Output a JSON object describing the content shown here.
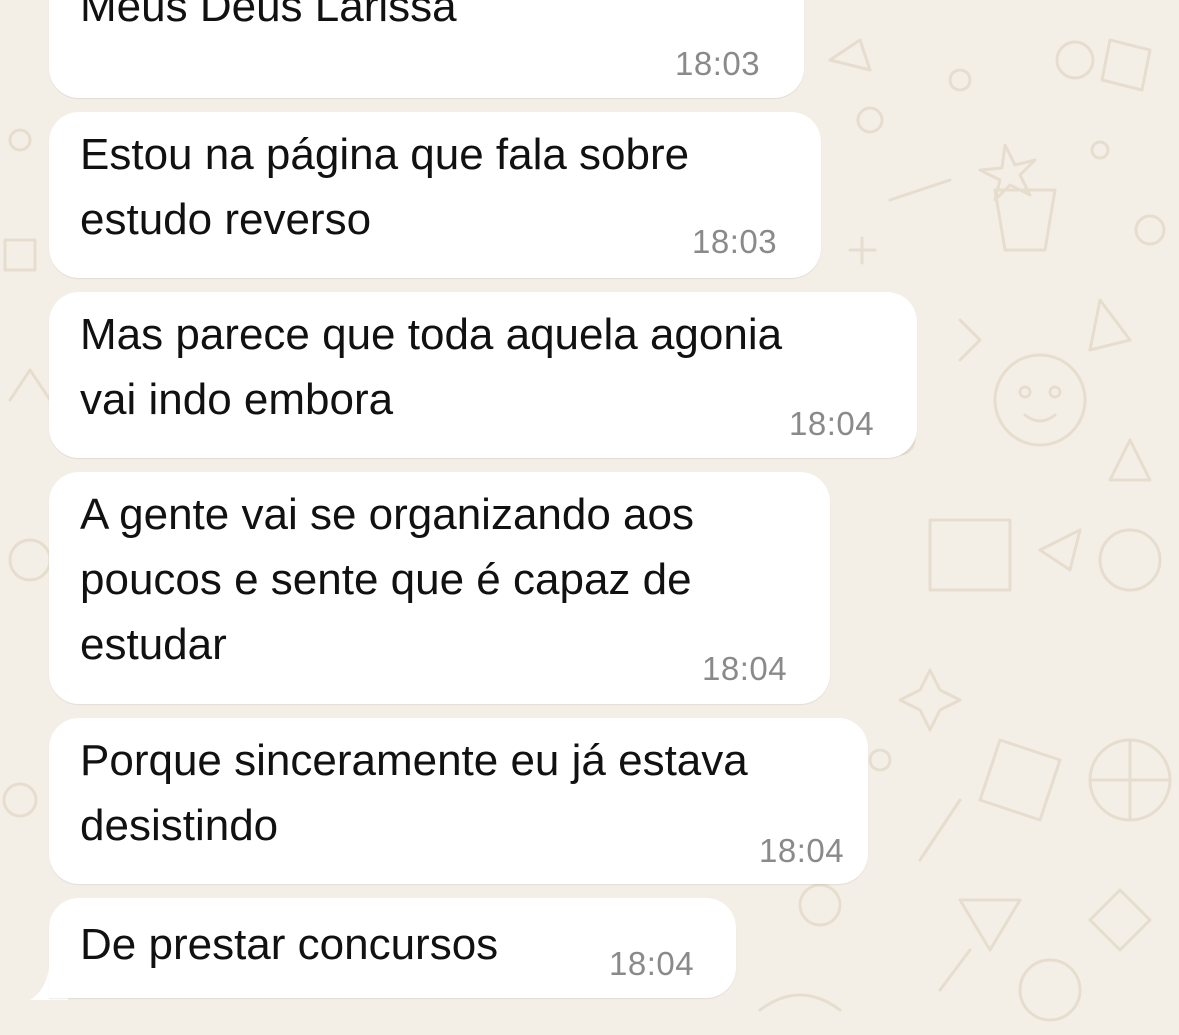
{
  "messages": [
    {
      "text": "Meus Deus Larissa",
      "time": "18:03"
    },
    {
      "text": "Estou na página que fala sobre\nestudo reverso",
      "time": "18:03"
    },
    {
      "text": "Mas parece que toda aquela agonia\nvai indo embora",
      "time": "18:04"
    },
    {
      "text": "A gente vai se organizando aos\npoucos e sente que é capaz de\nestudar",
      "time": "18:04"
    },
    {
      "text": "Porque sinceramente eu já estava\ndesistindo",
      "time": "18:04"
    },
    {
      "text": "De prestar concursos",
      "time": "18:04"
    }
  ],
  "colors": {
    "wallpaper": "#f4efe6",
    "doodle": "#e6ddce",
    "bubble": "#ffffff",
    "text": "#111111",
    "timestamp": "#8a8a8a"
  }
}
